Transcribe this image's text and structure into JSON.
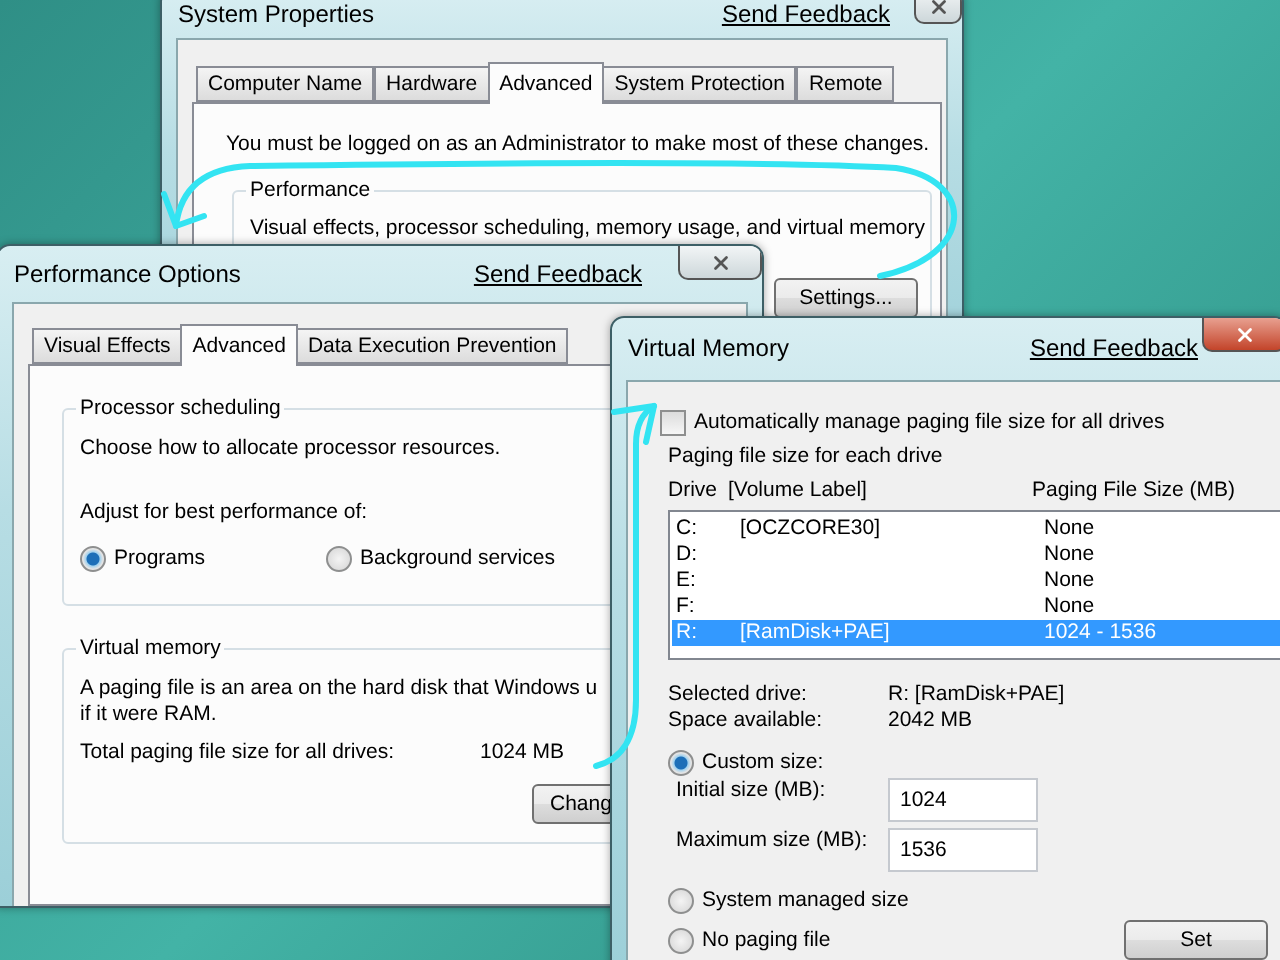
{
  "system_properties": {
    "title": "System Properties",
    "feedback": "Send Feedback",
    "tabs": [
      {
        "label": "Computer Name",
        "selected": false
      },
      {
        "label": "Hardware",
        "selected": false
      },
      {
        "label": "Advanced",
        "selected": true
      },
      {
        "label": "System Protection",
        "selected": false
      },
      {
        "label": "Remote",
        "selected": false
      }
    ],
    "notice": "You must be logged on as an Administrator to make most of these changes.",
    "performance": {
      "legend": "Performance",
      "description": "Visual effects, processor scheduling, memory usage, and virtual memory",
      "button": "Settings..."
    }
  },
  "performance_options": {
    "title": "Performance Options",
    "feedback": "Send Feedback",
    "tabs": [
      {
        "label": "Visual Effects",
        "selected": false
      },
      {
        "label": "Advanced",
        "selected": true
      },
      {
        "label": "Data Execution Prevention",
        "selected": false
      }
    ],
    "processor_scheduling": {
      "legend": "Processor scheduling",
      "description": "Choose how to allocate processor resources.",
      "prompt": "Adjust for best performance of:",
      "options": [
        {
          "label": "Programs",
          "selected": true
        },
        {
          "label": "Background services",
          "selected": false
        }
      ]
    },
    "virtual_memory": {
      "legend": "Virtual memory",
      "description_lines": [
        "A paging file is an area on the hard disk that Windows u",
        "if it were RAM."
      ],
      "total_label": "Total paging file size for all drives:",
      "total_value": "1024 MB",
      "button": "Chang"
    }
  },
  "virtual_memory": {
    "title": "Virtual Memory",
    "feedback": "Send Feedback",
    "auto_manage": {
      "label": "Automatically manage paging file size for all drives",
      "checked": false
    },
    "group_legend": "Paging file size for each drive",
    "columns": [
      "Drive",
      "[Volume Label]",
      "Paging File Size (MB)"
    ],
    "drives": [
      {
        "drive": "C:",
        "label": "[OCZCORE30]",
        "size": "None",
        "selected": false
      },
      {
        "drive": "D:",
        "size": "None",
        "selected": false
      },
      {
        "drive": "E:",
        "size": "None",
        "selected": false
      },
      {
        "drive": "F:",
        "size": "None",
        "selected": false
      },
      {
        "drive": "R:",
        "label": "[RamDisk+PAE]",
        "size": "1024 - 1536",
        "selected": true
      }
    ],
    "selected_drive_label": "Selected drive:",
    "selected_drive_value": "R:  [RamDisk+PAE]",
    "space_label": "Space available:",
    "space_value": "2042 MB",
    "size_options": [
      {
        "label": "Custom size:",
        "selected": true
      },
      {
        "label": "System managed size",
        "selected": false
      },
      {
        "label": "No paging file",
        "selected": false
      }
    ],
    "initial_label": "Initial size (MB):",
    "initial_value": "1024",
    "maximum_label": "Maximum size (MB):",
    "maximum_value": "1536",
    "set_button": "Set"
  }
}
